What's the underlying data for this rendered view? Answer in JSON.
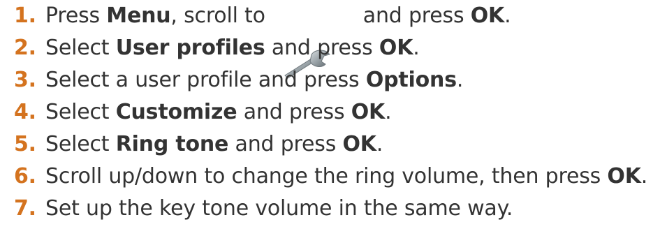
{
  "steps": [
    {
      "number": "1.",
      "parts": [
        "Press ",
        "Menu",
        ", scroll to",
        "and press ",
        "OK",
        "."
      ],
      "icon": "wrench-icon"
    },
    {
      "number": "2.",
      "parts": [
        "Select ",
        "User profiles",
        " and press ",
        "OK",
        "."
      ]
    },
    {
      "number": "3.",
      "parts": [
        "Select a user profile and press ",
        "Options",
        "."
      ]
    },
    {
      "number": "4.",
      "parts": [
        "Select ",
        "Customize",
        " and press ",
        "OK",
        "."
      ]
    },
    {
      "number": "5.",
      "parts": [
        "Select ",
        "Ring tone",
        " and press ",
        "OK",
        "."
      ]
    },
    {
      "number": "6.",
      "parts": [
        "Scroll up/down to change the ring volume, then press ",
        "OK",
        "."
      ]
    },
    {
      "number": "7.",
      "parts": [
        "Set up the key tone volume in the same way."
      ]
    }
  ],
  "colors": {
    "number": "#d4731f",
    "text": "#333333",
    "background": "#ffffff"
  }
}
